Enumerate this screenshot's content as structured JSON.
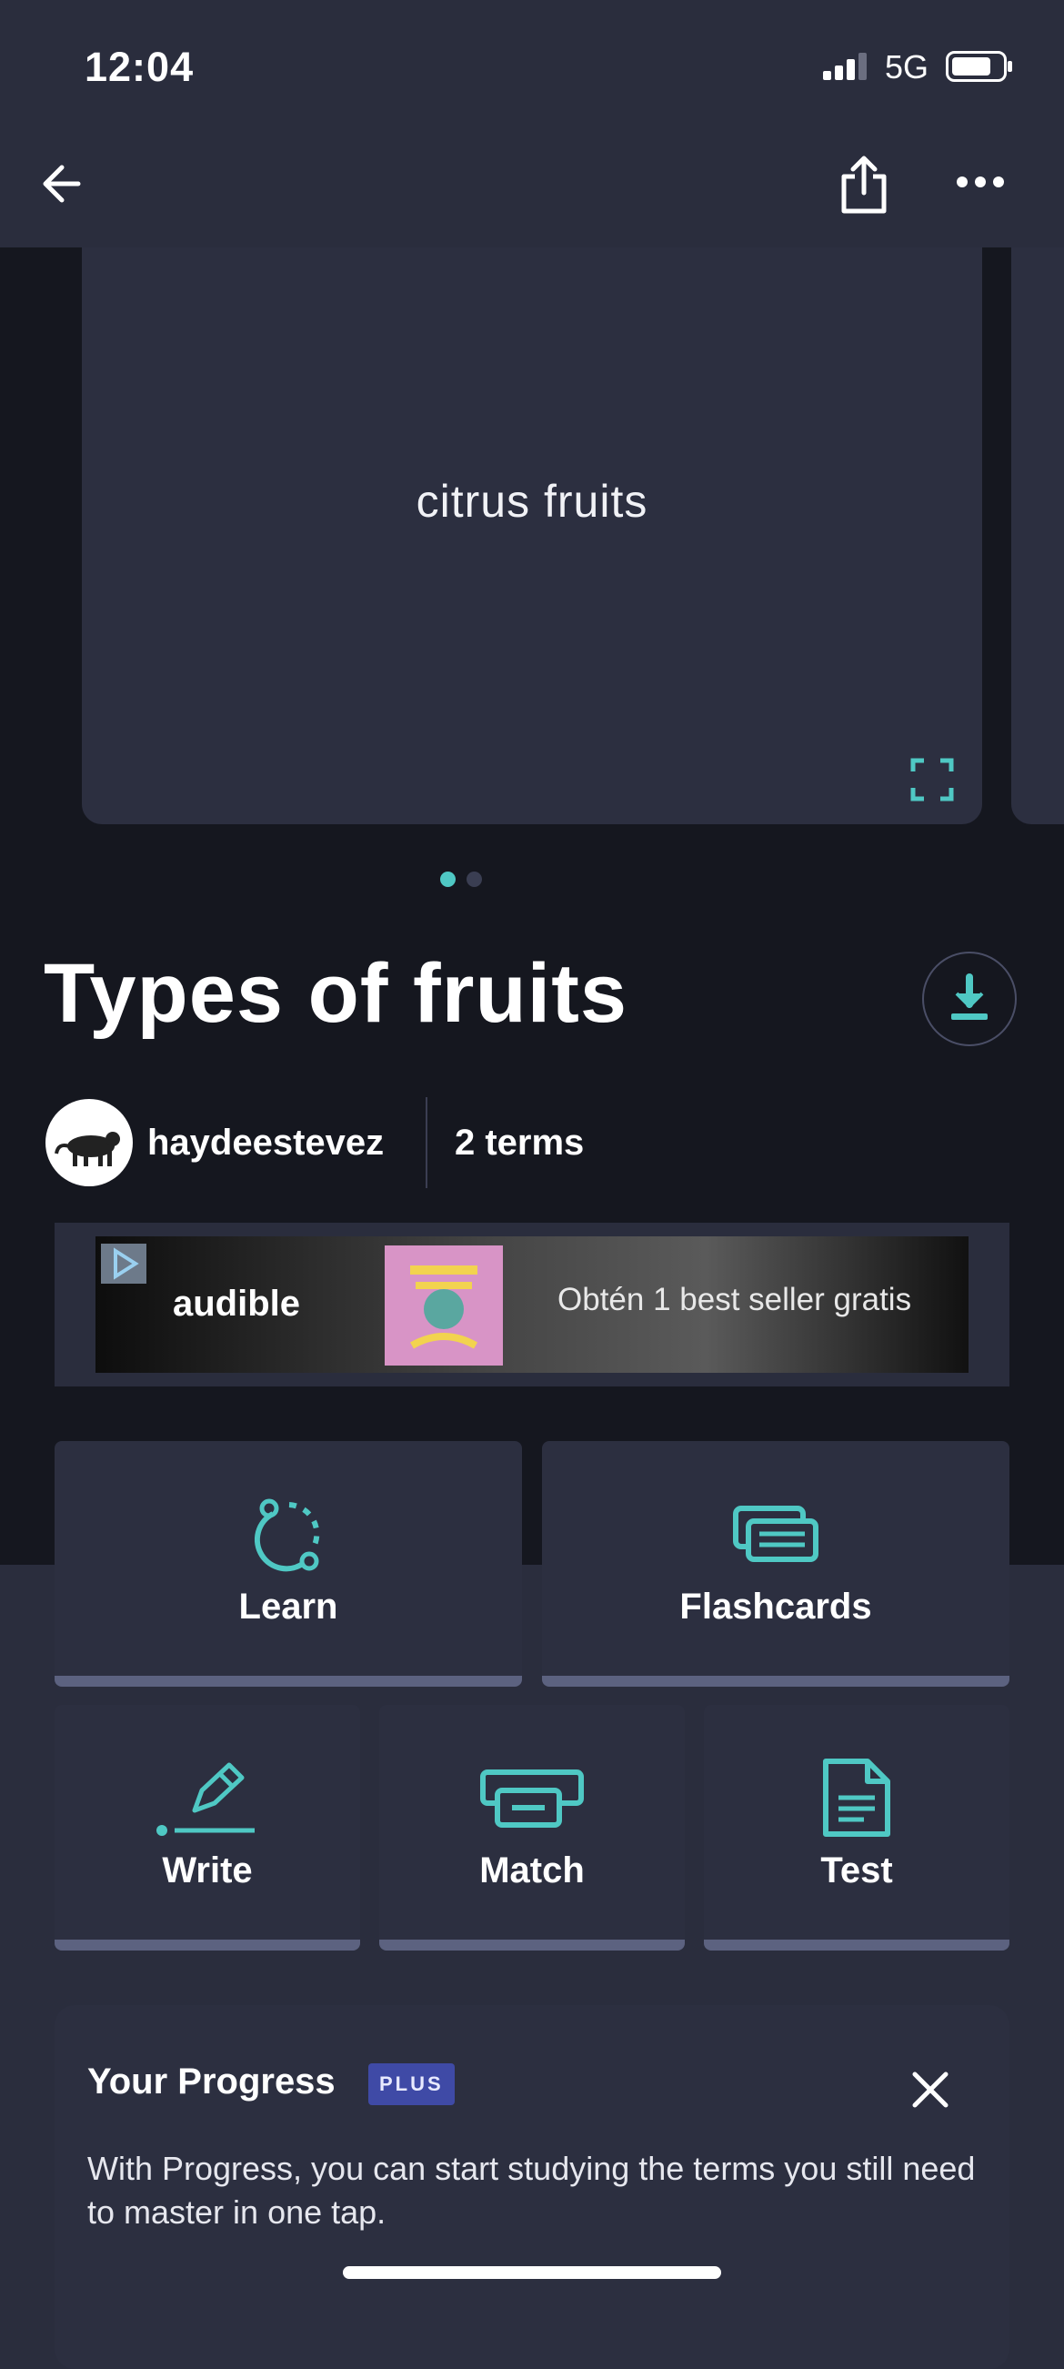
{
  "status": {
    "time": "12:04",
    "network": "5G"
  },
  "card": {
    "text": "citrus fruits"
  },
  "set": {
    "title": "Types of fruits",
    "creator": "haydeestevez",
    "terms": "2 terms"
  },
  "ad": {
    "brand": "audible",
    "text": "Obtén 1 best seller gratis"
  },
  "modes": {
    "learn": "Learn",
    "flashcards": "Flashcards",
    "write": "Write",
    "match": "Match",
    "test": "Test"
  },
  "progress": {
    "title": "Your Progress",
    "badge": "PLUS",
    "description": "With Progress, you can start studying the terms you still need to master in one tap."
  },
  "colors": {
    "accent": "#4fc8c4",
    "background": "#2a2d3d",
    "dark": "#15171f",
    "card": "#2c2f40",
    "badge": "#3f4aa6"
  },
  "icons": [
    "back-arrow-icon",
    "share-icon",
    "more-icon",
    "expand-icon",
    "download-icon",
    "learn-icon",
    "flashcards-icon",
    "write-icon",
    "match-icon",
    "test-icon",
    "close-icon"
  ]
}
